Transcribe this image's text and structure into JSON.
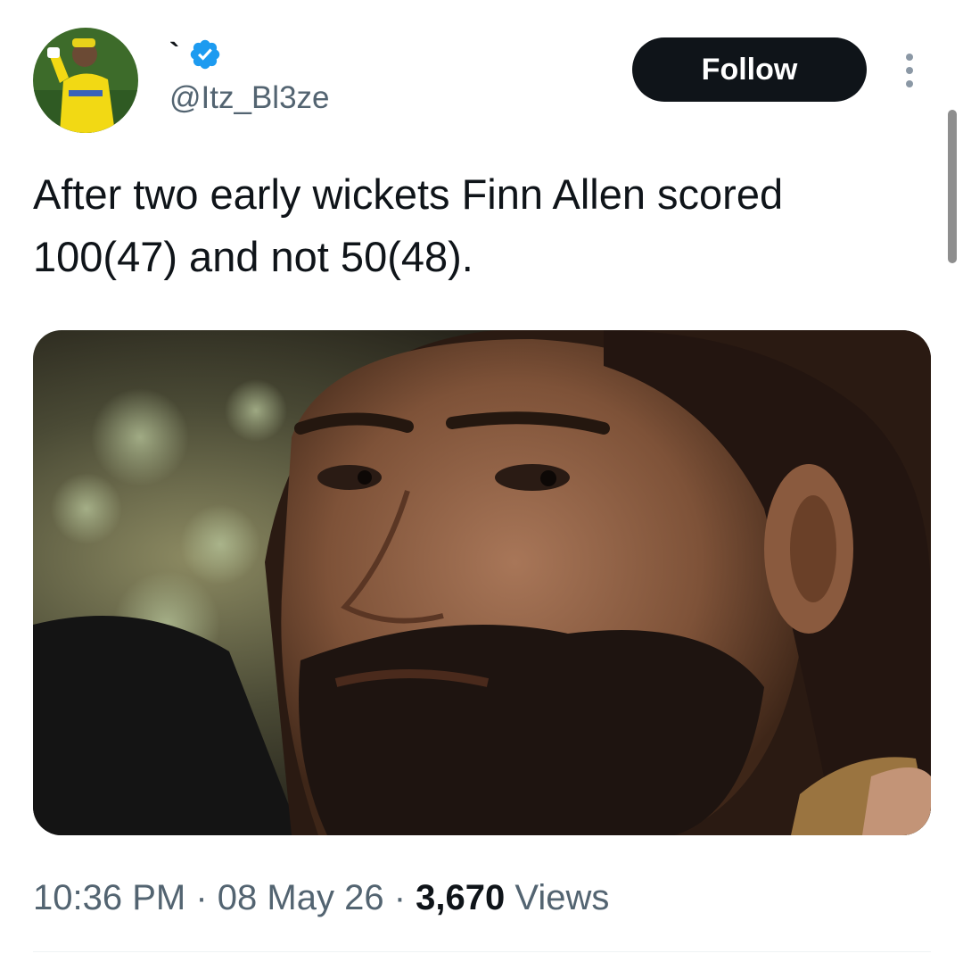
{
  "tweet": {
    "display_name": "`",
    "handle": "@Itz_Bl3ze",
    "verified": true,
    "follow_label": "Follow",
    "text_lines": [
      "After two early wickets Finn Allen scored",
      "100(47) and not 50(48)."
    ],
    "time": "10:36 PM",
    "date": "08 May 26",
    "separator": "·",
    "views_count": "3,670",
    "views_label": "Views"
  },
  "icons": {
    "verified": "verified-badge-icon",
    "more": "more-options-icon"
  },
  "colors": {
    "text_primary": "#0f1419",
    "text_secondary": "#536471",
    "follow_bg": "#0f1419",
    "verified_blue": "#1d9bf0"
  }
}
